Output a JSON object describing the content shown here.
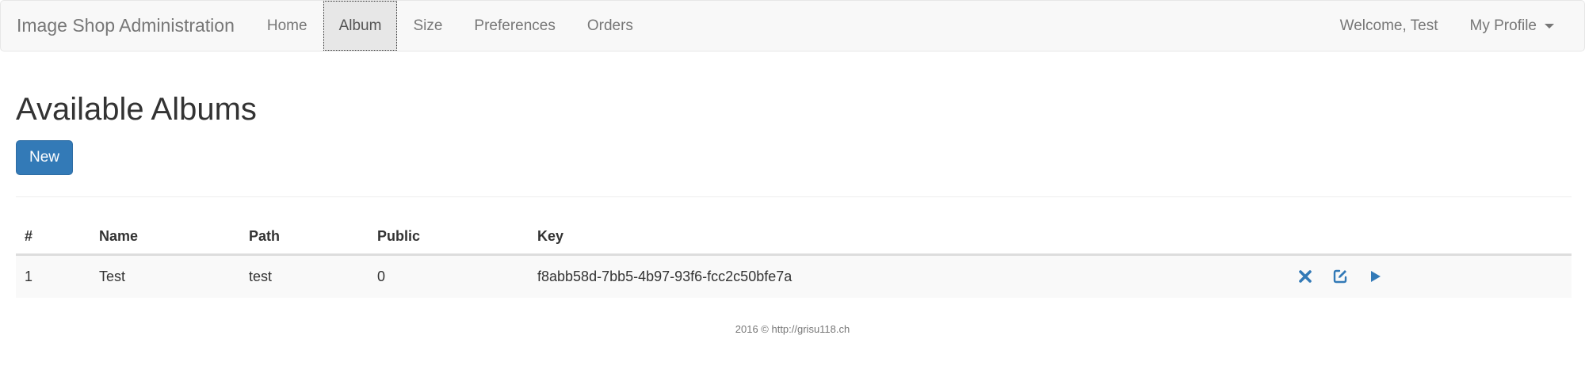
{
  "navbar": {
    "brand": "Image Shop Administration",
    "items": [
      {
        "label": "Home"
      },
      {
        "label": "Album"
      },
      {
        "label": "Size"
      },
      {
        "label": "Preferences"
      },
      {
        "label": "Orders"
      }
    ],
    "welcome": "Welcome, Test",
    "profile": "My Profile",
    "active_item": "Album"
  },
  "main": {
    "title": "Available Albums",
    "new_button": "New"
  },
  "table": {
    "headers": [
      "#",
      "Name",
      "Path",
      "Public",
      "Key"
    ],
    "rows": [
      {
        "num": "1",
        "name": "Test",
        "path": "test",
        "public": "0",
        "key": "f8abb58d-7bb5-4b97-93f6-fcc2c50bfe7a",
        "actions": [
          "delete-icon",
          "edit-icon",
          "play-icon"
        ]
      }
    ]
  },
  "footer": {
    "text": "2016 © http://grisu118.ch"
  },
  "colors": {
    "primary": "#337ab7",
    "navbar_bg": "#f8f8f8",
    "striped_row": "#f9f9f9"
  }
}
